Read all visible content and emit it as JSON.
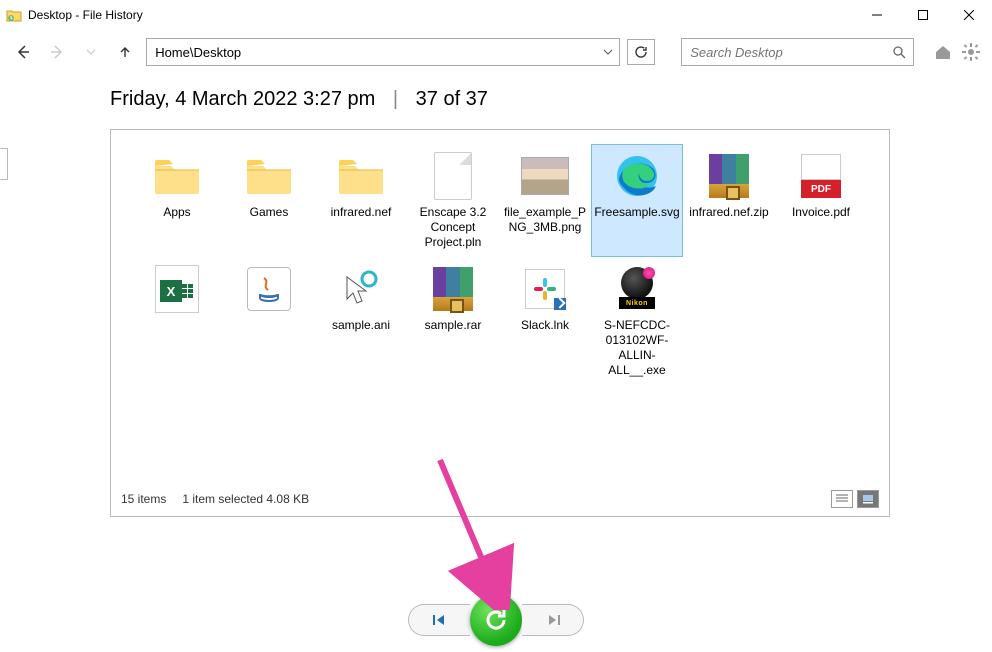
{
  "window": {
    "title": "Desktop - File History"
  },
  "nav": {
    "breadcrumb": "Home\\Desktop",
    "search_placeholder": "Search Desktop"
  },
  "header": {
    "timestamp": "Friday, 4 March 2022 3:27 pm",
    "separator": "|",
    "position": "37 of 37"
  },
  "files": [
    {
      "name": "Apps",
      "icon": "folder",
      "selected": false
    },
    {
      "name": "Games",
      "icon": "folder",
      "selected": false
    },
    {
      "name": "infrared.nef",
      "icon": "folder",
      "selected": false
    },
    {
      "name": "Enscape 3.2 Concept Project.pln",
      "icon": "blank",
      "selected": false
    },
    {
      "name": "file_example_PNG_3MB.png",
      "icon": "image",
      "selected": false
    },
    {
      "name": "Freesample.svg",
      "icon": "edge",
      "selected": true
    },
    {
      "name": "infrared.nef.zip",
      "icon": "archive",
      "selected": false
    },
    {
      "name": "Invoice.pdf",
      "icon": "pdf",
      "selected": false
    },
    {
      "name": "",
      "icon": "xlsx",
      "selected": false
    },
    {
      "name": "",
      "icon": "jar",
      "selected": false
    },
    {
      "name": "sample.ani",
      "icon": "cursor",
      "selected": false
    },
    {
      "name": "sample.rar",
      "icon": "archive",
      "selected": false
    },
    {
      "name": "Slack.lnk",
      "icon": "slack",
      "selected": false
    },
    {
      "name": "S-NEFCDC-013102WF-ALLIN-ALL__.exe",
      "icon": "nikon",
      "selected": false
    }
  ],
  "status": {
    "count": "15 items",
    "selection": "1 item selected  4.08 KB"
  },
  "pdf_label": "PDF",
  "nikon_label": "Nikon"
}
